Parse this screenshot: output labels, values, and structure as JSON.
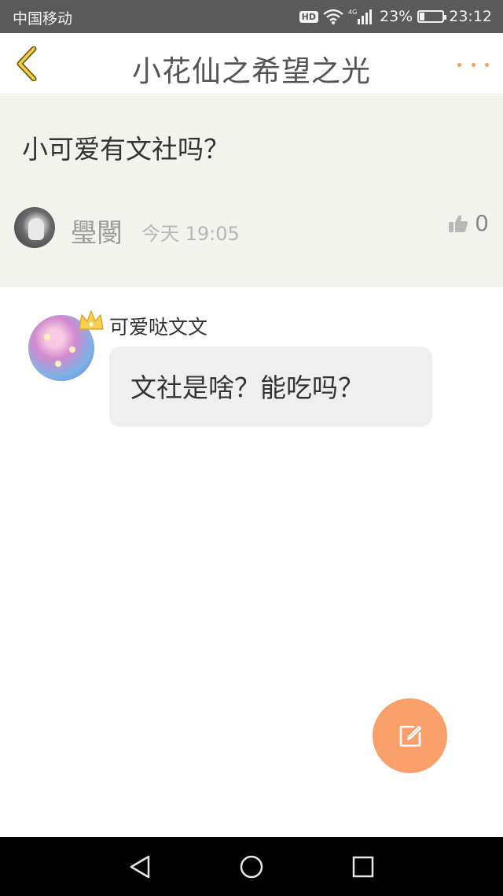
{
  "status_bar": {
    "carrier": "中国移动",
    "hd": "HD",
    "network": "4G",
    "battery_percent": "23%",
    "battery_level": 0.23,
    "time": "23:12"
  },
  "header": {
    "title": "小花仙之希望之光",
    "back_icon": "chevron-left-icon",
    "more_icon": "more-dots-icon",
    "accent_color": "#f4a05d"
  },
  "post": {
    "question": "小可爱有文社吗？",
    "author": "璺閿",
    "time": "今天 19:05",
    "likes": "0",
    "background": "#f3f3ee"
  },
  "reply": {
    "username": "可爱哒文文",
    "message": "文社是啥？能吃吗？",
    "badge_icon": "crown-icon"
  },
  "fab": {
    "icon": "edit-icon",
    "color": "#f99f6a"
  },
  "navbar": {
    "back_icon": "triangle-back-icon",
    "home_icon": "circle-home-icon",
    "recents_icon": "square-recents-icon"
  }
}
